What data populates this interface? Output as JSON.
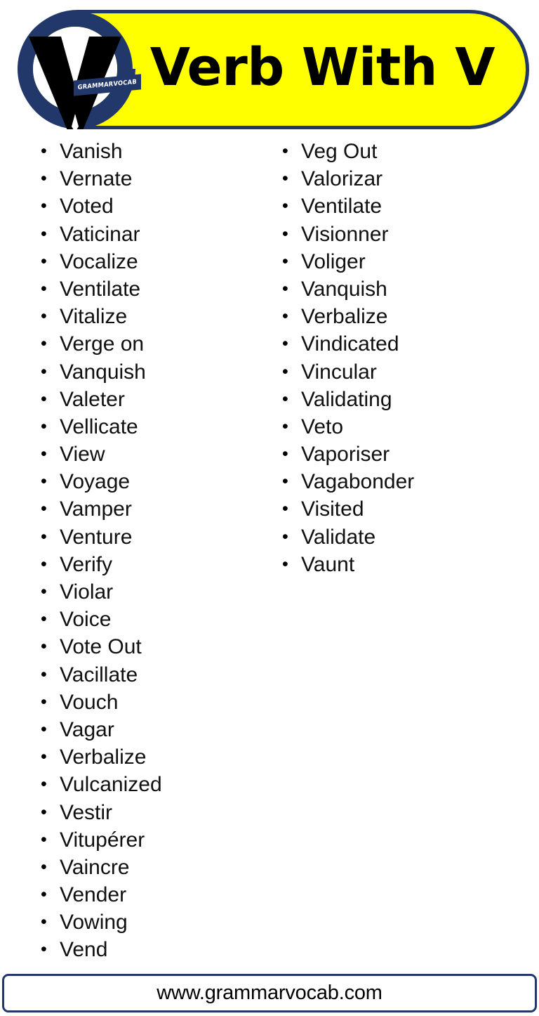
{
  "page": {
    "background_color": "#FFFFFF",
    "accent_navy": "#22386A",
    "accent_yellow": "#FFFF00",
    "text_color": "#101010"
  },
  "header": {
    "title": "Verb With V",
    "banner_color": "#FFFF00",
    "banner_border_color": "#22386A"
  },
  "logo": {
    "badge_text": "GRAMMARVOCAB",
    "ring_color": "#22386A",
    "letter_color": "#000000",
    "icon_name": "grammarvocab-logo"
  },
  "columns": {
    "left": {
      "items": [
        "Vanish",
        "Vernate",
        "Voted",
        "Vaticinar",
        "Vocalize",
        "Ventilate",
        "Vitalize",
        "Verge on",
        "Vanquish",
        "Valeter",
        "Vellicate",
        "View",
        "Voyage",
        "Vamper",
        "Venture",
        "Verify",
        "Violar",
        "Voice",
        "Vote Out",
        "Vacillate",
        "Vouch",
        "Vagar",
        "Verbalize",
        "Vulcanized",
        "Vestir",
        "Vitupérer",
        "Vaincre",
        "Vender",
        "Vowing",
        "Vend"
      ]
    },
    "right": {
      "items": [
        "Veg Out",
        "Valorizar",
        "Ventilate",
        "Visionner",
        "Voliger",
        "Vanquish",
        "Verbalize",
        "Vindicated",
        "Vincular",
        "Validating",
        "Veto",
        "Vaporiser",
        "Vagabonder",
        "Visited",
        "Validate",
        "Vaunt"
      ]
    }
  },
  "footer": {
    "url": "www.grammarvocab.com"
  }
}
